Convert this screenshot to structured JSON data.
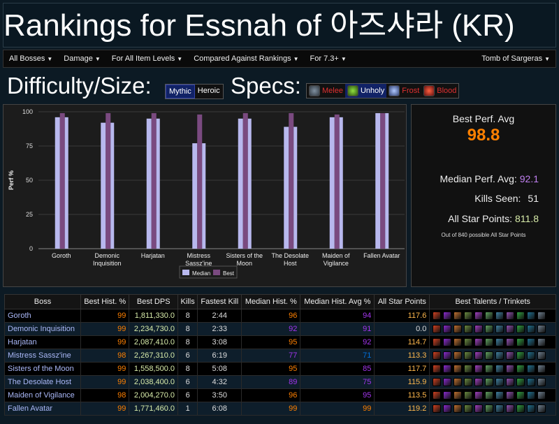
{
  "page_title": "Rankings for Essnah of 아즈샤라 (KR)",
  "menu": {
    "items": [
      "All Bosses",
      "Damage",
      "For All Item Levels",
      "Compared Against Rankings",
      "For 7.3+"
    ],
    "right": "Tomb of Sargeras"
  },
  "difficulty": {
    "label": "Difficulty/Size:",
    "options": [
      "Mythic",
      "Heroic"
    ],
    "selected": "Mythic"
  },
  "specs": {
    "label": "Specs:",
    "items": [
      {
        "label": "Melee",
        "color": "#e03030",
        "icon": "melee-spec-icon",
        "active": false
      },
      {
        "label": "Unholy",
        "color": "#ffffff",
        "icon": "unholy-spec-icon",
        "active": true
      },
      {
        "label": "Frost",
        "color": "#e03030",
        "icon": "frost-spec-icon",
        "active": false
      },
      {
        "label": "Blood",
        "color": "#e03030",
        "icon": "blood-spec-icon",
        "active": false
      }
    ]
  },
  "chart_data": {
    "type": "bar",
    "ylabel": "Perf %",
    "ylim": [
      0,
      100
    ],
    "yticks": [
      0,
      25,
      50,
      75,
      100
    ],
    "categories": [
      "Goroth",
      "Demonic Inquisition",
      "Harjatan",
      "Mistress Sassz'ine",
      "Sisters of the Moon",
      "The Desolate Host",
      "Maiden of Vigilance",
      "Fallen Avatar"
    ],
    "category_lines": [
      [
        "Goroth"
      ],
      [
        "Demonic",
        "Inquisition"
      ],
      [
        "Harjatan"
      ],
      [
        "Mistress",
        "Sassz'ine"
      ],
      [
        "Sisters of the",
        "Moon"
      ],
      [
        "The Desolate",
        "Host"
      ],
      [
        "Maiden of",
        "Vigilance"
      ],
      [
        "Fallen Avatar"
      ]
    ],
    "series": [
      {
        "name": "Median",
        "color": "#b8b8ee",
        "values": [
          96,
          92,
          95,
          77,
          95,
          89,
          96,
          99
        ]
      },
      {
        "name": "Best",
        "color": "#7a4a80",
        "values": [
          99,
          99,
          99,
          98,
          99,
          99,
          98,
          99
        ]
      }
    ],
    "legend": "bottom"
  },
  "stats": {
    "best_label": "Best Perf. Avg",
    "best_value": "98.8",
    "median_label": "Median Perf. Avg:",
    "median_value": "92.1",
    "kills_label": "Kills Seen:",
    "kills_value": "51",
    "points_label": "All Star Points:",
    "points_value": "811.8",
    "note": "Out of 840 possible All Star Points"
  },
  "table": {
    "headers": [
      "Boss",
      "Best Hist. %",
      "Best DPS",
      "Kills",
      "Fastest Kill",
      "Median Hist. %",
      "Median Hist. Avg %",
      "All Star Points",
      "Best Talents / Trinkets"
    ],
    "rows": [
      {
        "boss": "Goroth",
        "best": "99",
        "dps": "1,811,330.0",
        "kills": "8",
        "fastest": "2:44",
        "median": "96",
        "avg": "94",
        "points": "117.6",
        "best_cls": "leg",
        "median_cls": "leg",
        "avg_cls": "epic"
      },
      {
        "boss": "Demonic Inquisition",
        "best": "99",
        "dps": "2,234,730.0",
        "kills": "8",
        "fastest": "2:33",
        "median": "92",
        "avg": "91",
        "points": "0.0",
        "best_cls": "leg",
        "median_cls": "epic",
        "avg_cls": "epic"
      },
      {
        "boss": "Harjatan",
        "best": "99",
        "dps": "2,087,410.0",
        "kills": "8",
        "fastest": "3:08",
        "median": "95",
        "avg": "92",
        "points": "114.7",
        "best_cls": "leg",
        "median_cls": "leg",
        "avg_cls": "epic"
      },
      {
        "boss": "Mistress Sassz'ine",
        "best": "98",
        "dps": "2,267,310.0",
        "kills": "6",
        "fastest": "6:19",
        "median": "77",
        "avg": "71",
        "points": "113.3",
        "best_cls": "leg",
        "median_cls": "epic",
        "avg_cls": "rare"
      },
      {
        "boss": "Sisters of the Moon",
        "best": "99",
        "dps": "1,558,500.0",
        "kills": "8",
        "fastest": "5:08",
        "median": "95",
        "avg": "85",
        "points": "117.7",
        "best_cls": "leg",
        "median_cls": "leg",
        "avg_cls": "epic"
      },
      {
        "boss": "The Desolate Host",
        "best": "99",
        "dps": "2,038,400.0",
        "kills": "6",
        "fastest": "4:32",
        "median": "89",
        "avg": "75",
        "points": "115.9",
        "best_cls": "leg",
        "median_cls": "epic",
        "avg_cls": "epic"
      },
      {
        "boss": "Maiden of Vigilance",
        "best": "98",
        "dps": "2,004,270.0",
        "kills": "6",
        "fastest": "3:50",
        "median": "96",
        "avg": "95",
        "points": "113.5",
        "best_cls": "leg",
        "median_cls": "leg",
        "avg_cls": "epic"
      },
      {
        "boss": "Fallen Avatar",
        "best": "99",
        "dps": "1,771,460.0",
        "kills": "1",
        "fastest": "6:08",
        "median": "99",
        "avg": "99",
        "points": "119.2",
        "best_cls": "leg",
        "median_cls": "leg",
        "avg_cls": "leg"
      }
    ],
    "talent_colors": [
      "#d04020",
      "#8a2ad0",
      "#c07030",
      "#6a8a40",
      "#a040c0",
      "#60a060",
      "#4080a0",
      "#9050b0",
      "#30a040",
      "#207090",
      "#708090"
    ]
  }
}
